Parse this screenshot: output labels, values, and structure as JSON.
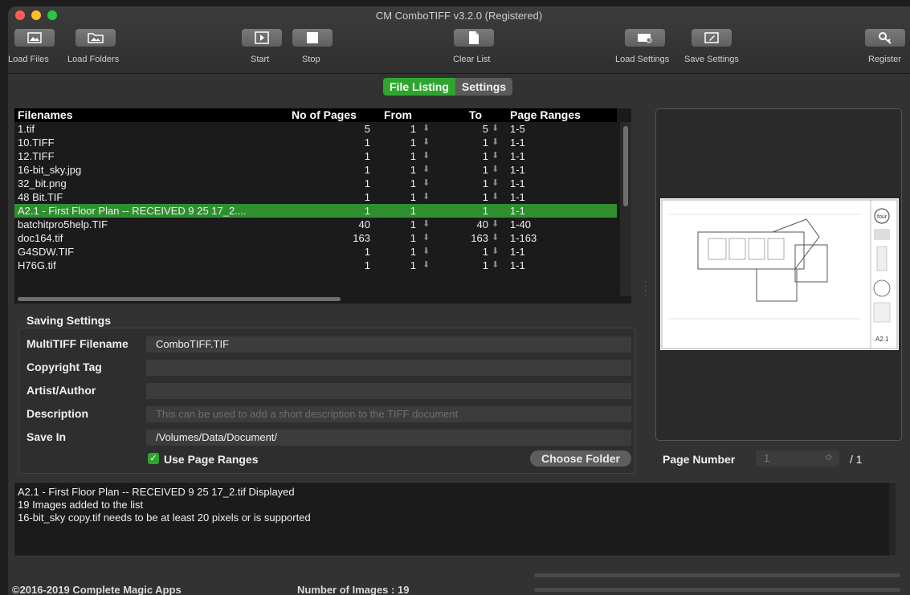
{
  "window": {
    "title": "CM ComboTIFF v3.2.0 (Registered)"
  },
  "toolbar": {
    "load_files": "Load Files",
    "load_folders": "Load Folders",
    "start": "Start",
    "stop": "Stop",
    "clear_list": "Clear List",
    "load_settings": "Load Settings",
    "save_settings": "Save Settings",
    "register": "Register"
  },
  "tabs": {
    "file_listing": "File Listing",
    "settings": "Settings",
    "active": "File Listing"
  },
  "table": {
    "columns": [
      "Filenames",
      "No of Pages",
      "From",
      "To",
      "Page Ranges"
    ],
    "rows": [
      {
        "name": "1.tif",
        "pages": "5",
        "from": "1",
        "to": "5",
        "range": "1-5"
      },
      {
        "name": "10.TIFF",
        "pages": "1",
        "from": "1",
        "to": "1",
        "range": "1-1"
      },
      {
        "name": "12.TIFF",
        "pages": "1",
        "from": "1",
        "to": "1",
        "range": "1-1"
      },
      {
        "name": "16-bit_sky.jpg",
        "pages": "1",
        "from": "1",
        "to": "1",
        "range": "1-1"
      },
      {
        "name": "32_bit.png",
        "pages": "1",
        "from": "1",
        "to": "1",
        "range": "1-1"
      },
      {
        "name": "48 Bit.TIF",
        "pages": "1",
        "from": "1",
        "to": "1",
        "range": "1-1"
      },
      {
        "name": "A2.1 - First Floor Plan -- RECEIVED 9 25 17_2....",
        "pages": "1",
        "from": "1",
        "to": "1",
        "range": "1-1"
      },
      {
        "name": "batchitpro5help.TIF",
        "pages": "40",
        "from": "1",
        "to": "40",
        "range": "1-40"
      },
      {
        "name": "doc164.tif",
        "pages": "163",
        "from": "1",
        "to": "163",
        "range": "1-163"
      },
      {
        "name": "G4SDW.TIF",
        "pages": "1",
        "from": "1",
        "to": "1",
        "range": "1-1"
      },
      {
        "name": "H76G.tif",
        "pages": "1",
        "from": "1",
        "to": "1",
        "range": "1-1"
      }
    ],
    "selected_row": "A2.1 - First Floor Plan -- RECEIVED 9 25 17_2...."
  },
  "saving": {
    "title": "Saving Settings",
    "multitiff_label": "MultiTIFF Filename",
    "multitiff_value": "ComboTIFF.TIF",
    "copyright_label": "Copyright Tag",
    "copyright_value": "",
    "artist_label": "Artist/Author",
    "artist_value": "",
    "description_label": "Description",
    "description_placeholder": "This can be used to add a short description to the TIFF document",
    "save_in_label": "Save In",
    "save_in_value": "/Volumes/Data/Document/",
    "use_page_ranges_label": "Use Page Ranges",
    "use_page_ranges_checked": true,
    "choose_folder": "Choose Folder"
  },
  "preview": {
    "page_number_label": "Page Number",
    "page_number_value": "1",
    "page_total": "/ 1"
  },
  "log": {
    "lines": [
      "A2.1 - First Floor Plan -- RECEIVED 9 25 17_2.tif Displayed",
      "19 Images added to the list",
      "16-bit_sky copy.tif needs to be at least 20 pixels or is supported"
    ]
  },
  "footer": {
    "copyright": "©2016-2019 Complete Magic Apps",
    "count": "Number of Images : 19"
  },
  "colors": {
    "accent": "#2fa52f",
    "selected_row": "#2f8f2f",
    "background": "#323232"
  }
}
